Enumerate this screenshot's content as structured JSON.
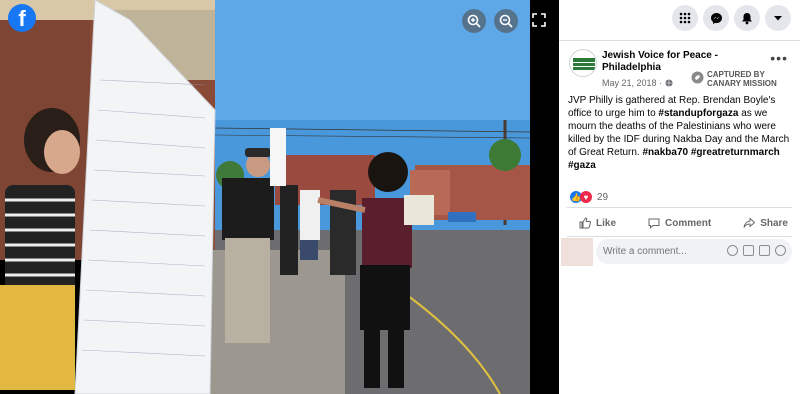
{
  "post": {
    "page_name": "Jewish Voice for Peace - Philadelphia",
    "date": "May 21, 2018",
    "body_plain": "JVP Philly is gathered at Rep. Brendan Boyle's office to urge him to ",
    "hashtag1": "#standupforgaza",
    "body_plain2": " as we mourn the deaths of the Palestinians who were killed by the IDF during Nakba Day and the March of Great Return. ",
    "hashtag2": "#nakba70",
    "hashtag3": "#greatreturnmarch",
    "hashtag4": "#gaza",
    "reaction_count": "29"
  },
  "watermark": {
    "line1": "CAPTURED BY",
    "line2": "CANARY MISSION"
  },
  "actions": {
    "like": "Like",
    "comment": "Comment",
    "share": "Share"
  },
  "comment_box": {
    "placeholder": "Write a comment..."
  },
  "icons": {
    "logo": "facebook-logo-icon",
    "zoom_in": "zoom-in-icon",
    "zoom_out": "zoom-out-icon",
    "expand": "expand-icon",
    "menu": "grid-menu-icon",
    "messenger": "messenger-icon",
    "notifications": "bell-icon",
    "account": "caret-down-icon",
    "globe": "globe-icon"
  },
  "colors": {
    "facebook_blue": "#1877f2",
    "panel_bg": "#ffffff",
    "secondary_text": "#65676b"
  }
}
